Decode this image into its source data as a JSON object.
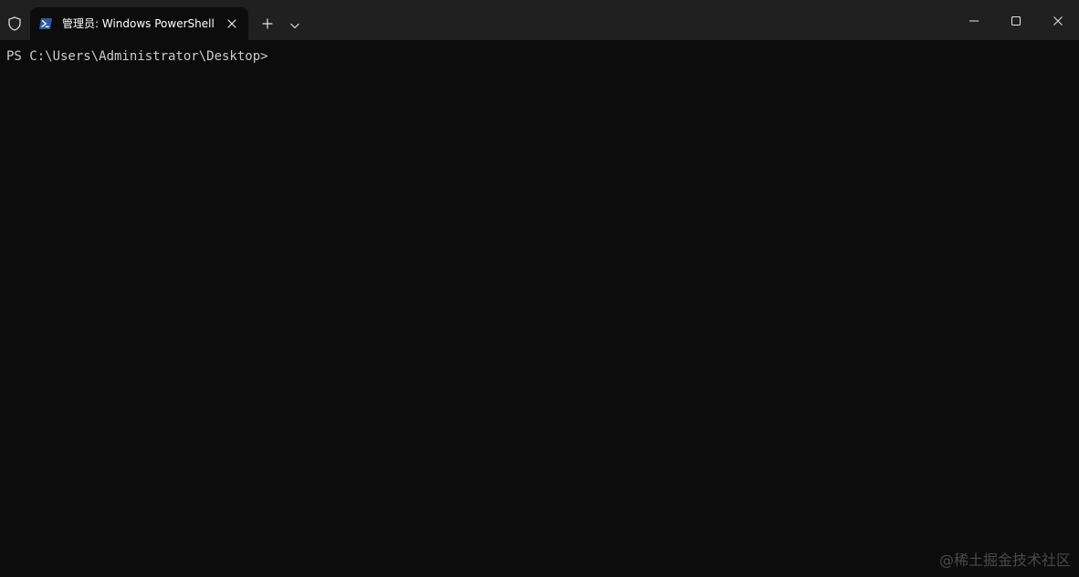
{
  "titlebar": {
    "admin_icon": "shield-icon",
    "tab": {
      "icon": "powershell-icon",
      "title": "管理员: Windows PowerShell",
      "close_icon": "close-icon"
    },
    "new_tab_icon": "plus-icon",
    "dropdown_icon": "chevron-down-icon",
    "window_controls": [
      "minimize-icon",
      "maximize-icon",
      "close-icon"
    ]
  },
  "terminal": {
    "prompt": "PS C:\\Users\\Administrator\\Desktop>"
  },
  "watermark": "@稀土掘金技术社区",
  "colors": {
    "titlebar_bg": "#202020",
    "terminal_bg": "#0c0c0c",
    "text": "#cccccc",
    "accent_powershell": "#2c5aa0"
  }
}
